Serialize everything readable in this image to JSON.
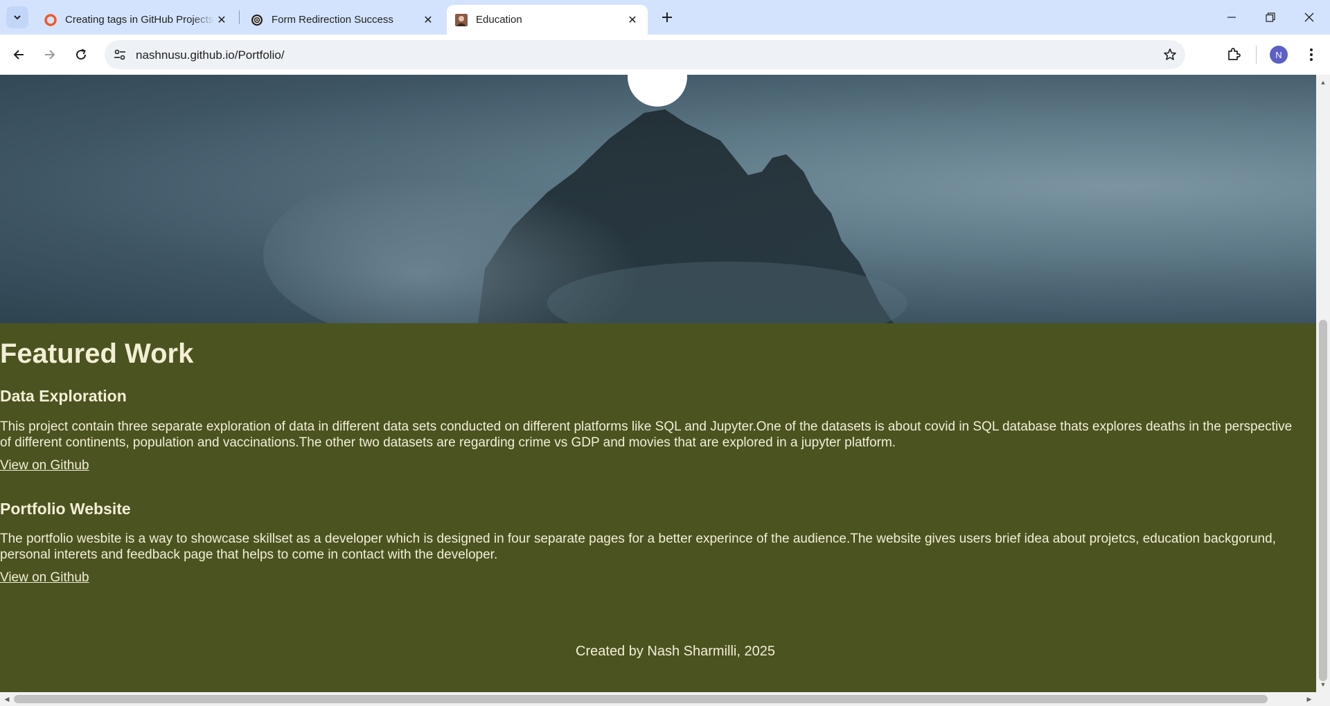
{
  "browser": {
    "tabs": [
      {
        "title": "Creating tags in GitHub Projects",
        "favicon": "orange-circle-icon",
        "active": false
      },
      {
        "title": "Form Redirection Success",
        "favicon": "openai-logo-icon",
        "active": false
      },
      {
        "title": "Education",
        "favicon": "portrait-icon",
        "active": true
      }
    ],
    "url": "nashnusu.github.io/Portfolio/",
    "profile_initial": "N"
  },
  "page": {
    "featured": {
      "title": "Featured Work",
      "projects": [
        {
          "name": "Data Exploration",
          "description": "This project contain three separate exploration of data in different data sets conducted on different platforms like SQL and Jupyter.One of the datasets is about covid in SQL database thats explores deaths in the perspective of different continents, population and vaccinations.The other two datasets are regarding crime vs GDP and movies that are explored in a jupyter platform.",
          "link_label": "View on Github"
        },
        {
          "name": "Portfolio Website",
          "description": "The portfolio wesbite is a way to showcase skillset as a developer which is designed in four separate pages for a better experince of the audience.The website gives users brief idea about projetcs, education backgorund, personal interets and feedback page that helps to come in contact with the developer.",
          "link_label": "View on Github"
        }
      ]
    },
    "footer": "Created by Nash Sharmilli, 2025"
  },
  "colors": {
    "featured_bg": "#4b5320",
    "featured_text": "#f3efd5",
    "tabstrip_bg": "#d3e3fd"
  }
}
